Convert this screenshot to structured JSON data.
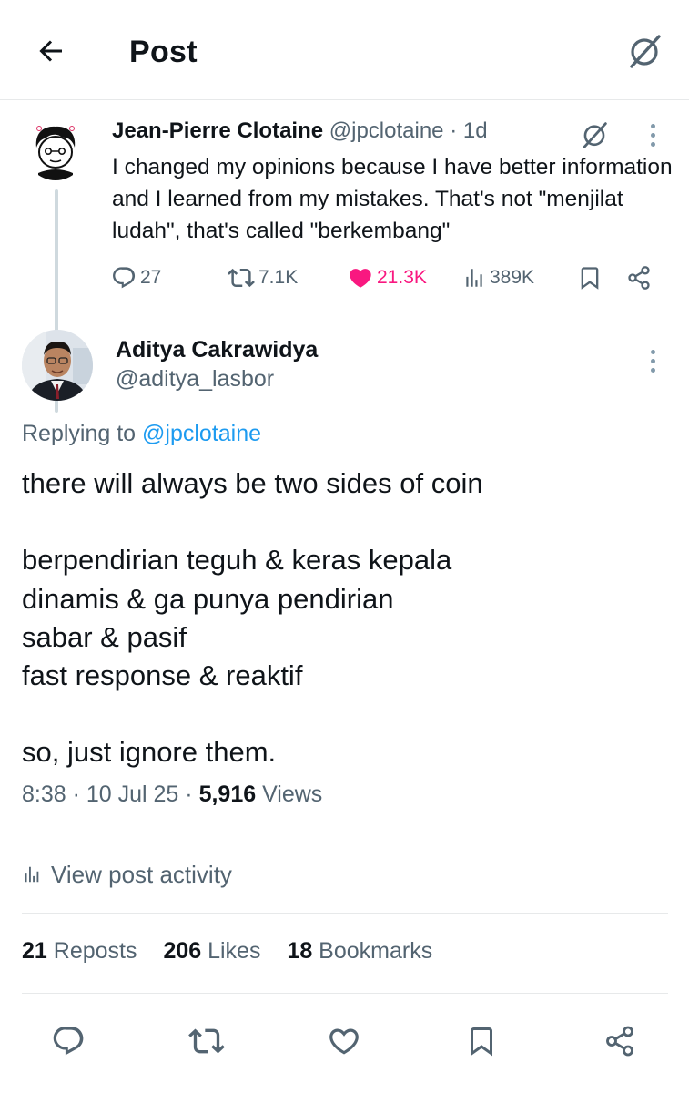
{
  "header": {
    "title": "Post",
    "back_icon": "arrow-left-icon",
    "grok_icon": "grok-icon"
  },
  "parent_post": {
    "author_name": "Jean-Pierre Clotaine",
    "author_handle": "@jpclotaine",
    "time": "· 1d",
    "text": "I changed my opinions because I have better information and I learned from my mistakes. That's not \"menjilat ludah\", that's called \"berkembang\"",
    "replies": "27",
    "reposts": "7.1K",
    "likes": "21.3K",
    "views": "389K",
    "like_color": "#f91880"
  },
  "main_post": {
    "author_name": "Aditya Cakrawidya",
    "author_handle": "@aditya_lasbor",
    "replying_prefix": "Replying to ",
    "replying_to": "@jpclotaine",
    "lines": [
      "there will always be two sides of coin",
      "",
      "berpendirian teguh & keras kepala",
      "dinamis & ga punya pendirian",
      "sabar & pasif",
      "fast response & reaktif",
      "",
      "so, just ignore them."
    ],
    "time": "8:38 · 10 Jul 25 · ",
    "views_count": "5,916",
    "views_label": " Views"
  },
  "activity": {
    "label": "View post activity"
  },
  "stats": {
    "reposts_count": "21",
    "reposts_label": " Reposts",
    "likes_count": "206",
    "likes_label": " Likes",
    "bookmarks_count": "18",
    "bookmarks_label": " Bookmarks"
  },
  "colors": {
    "text": "#0f1419",
    "secondary": "#536471",
    "link": "#1d9bf0",
    "divider": "#e7e9ea"
  }
}
